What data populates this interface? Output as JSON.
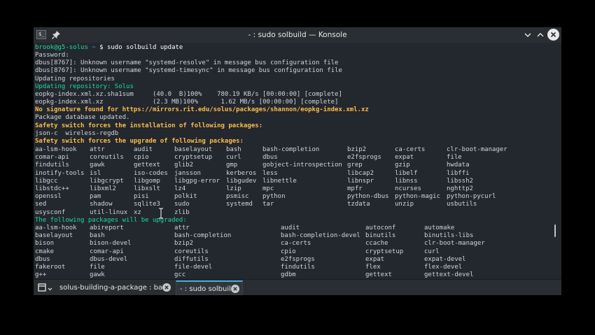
{
  "window": {
    "title": "- : sudo solbuild — Konsole",
    "colors": {
      "background": "#23272e",
      "titlebar": "#2a2e32",
      "accent": "#3daee9",
      "green": "#1cdc9a",
      "yellow": "#fdbc4b"
    }
  },
  "icons": [
    "terminal-app-icon",
    "pin-icon",
    "minimize-icon",
    "maximize-icon",
    "close-icon",
    "new-tab-icon",
    "chevron-down-icon",
    "tab-close-icon",
    "ibeam-cursor-icon"
  ],
  "prompt": {
    "user": "brook@g5-solus",
    "path": "~",
    "symbol": "$",
    "command": "sudo solbuild update"
  },
  "output": {
    "password": "Password:",
    "dbus1": "dbus[8767]: Unknown username \"systemd-resolve\" in message bus configuration file",
    "dbus2": "dbus[8767]: Unknown username \"systemd-timesync\" in message bus configuration file",
    "updating": "Updating repositories",
    "updating_repo": "Updating repository: Solus",
    "dl1": "eopkg-index.xml.xz.sha1sum     (40.0  B)100%    780.19 KB/s [00:00:00] [complete]",
    "dl2": "eopkg-index.xml.xz             (2.3 MB)100%      1.62 MB/s [00:00:00] [complete]",
    "nosig": "No signature found for https://mirrors.rit.edu/solus/packages/shannon/eopkg-index.xml.xz",
    "db_updated": "Package database updated.",
    "safety_install": "Safety switch forces the installation of following packages:",
    "install_list": "json-c  wireless-regdb",
    "safety_upgrade": "Safety switch forces the upgrade of following packages:",
    "upgrade_header": "The following packages will be upgraded:"
  },
  "safety_upgrade_rows": [
    [
      "aa-lsm-hook",
      "attr",
      "audit",
      "baselayout",
      "bash",
      "bash-completion",
      "bzip2",
      "ca-certs",
      "clr-boot-manager"
    ],
    [
      "comar-api",
      "coreutils",
      "cpio",
      "cryptsetup",
      "curl",
      "dbus",
      "e2fsprogs",
      "expat",
      "file"
    ],
    [
      "findutils",
      "gawk",
      "gettext",
      "glib2",
      "gmp",
      "gobject-introspection",
      "grep",
      "gzip",
      "hwdata"
    ],
    [
      "inotify-tools",
      "isl",
      "iso-codes",
      "jansson",
      "kerberos",
      "less",
      "libcap2",
      "libelf",
      "libffi"
    ],
    [
      "libgcc",
      "libgcrypt",
      "libgomp",
      "libgpg-error",
      "libgudev",
      "libnettle",
      "libnspr",
      "libnss",
      "libssh2"
    ],
    [
      "libstdc++",
      "libxml2",
      "libxslt",
      "lz4",
      "lzip",
      "mpc",
      "mpfr",
      "ncurses",
      "nghttp2"
    ],
    [
      "openssl",
      "pam",
      "pisi",
      "polkit",
      "psmisc",
      "python",
      "python-dbus",
      "python-magic",
      "python-pycurl"
    ],
    [
      "sed",
      "shadow",
      "sqlite3",
      "sudo",
      "systemd",
      "tar",
      "tzdata",
      "unzip",
      "usbutils"
    ],
    [
      "usysconf",
      "util-linux",
      "xz",
      "zlib",
      "",
      "",
      "",
      "",
      ""
    ]
  ],
  "upgrade_rows": [
    [
      "aa-lsm-hook",
      "abireport",
      "attr",
      "audit",
      "autoconf",
      "automake"
    ],
    [
      "baselayout",
      "bash",
      "bash-completion",
      "bash-completion-devel",
      "binutils",
      "binutils-libs"
    ],
    [
      "bison",
      "bison-devel",
      "bzip2",
      "ca-certs",
      "ccache",
      "clr-boot-manager"
    ],
    [
      "cmake",
      "comar-api",
      "coreutils",
      "cpio",
      "cryptsetup",
      "curl"
    ],
    [
      "dbus",
      "dbus-devel",
      "diffutils",
      "e2fsprogs",
      "expat",
      "expat-devel"
    ],
    [
      "fakeroot",
      "file",
      "file-devel",
      "findutils",
      "flex",
      "flex-devel"
    ],
    [
      "g++",
      "gawk",
      "gcc",
      "gdbm",
      "gettext",
      "gettext-devel"
    ]
  ],
  "tabs": [
    {
      "label": "solus-building-a-package : bash",
      "active": false
    },
    {
      "label": "- : sudo solbuild",
      "active": true
    }
  ]
}
